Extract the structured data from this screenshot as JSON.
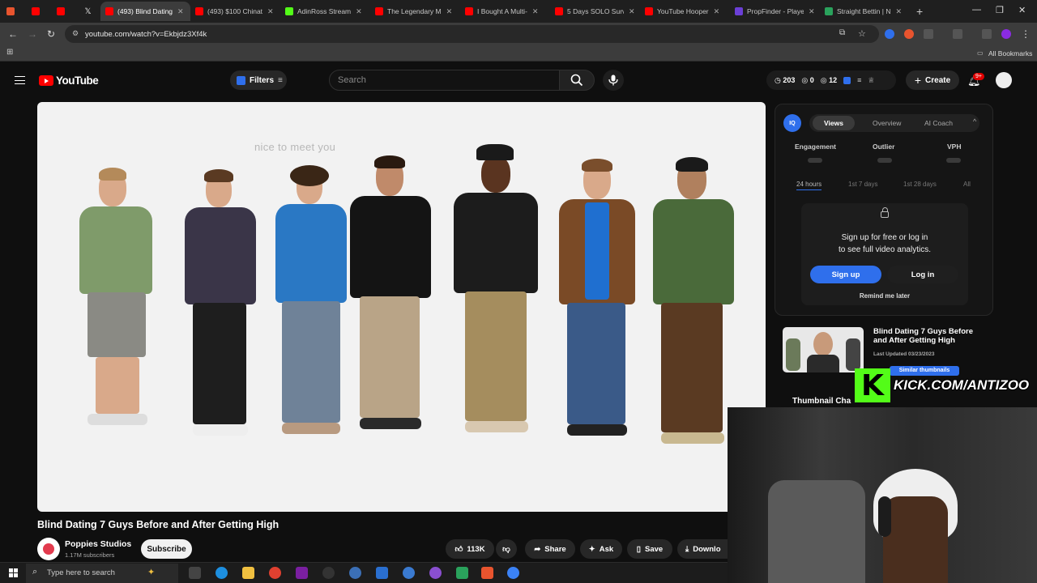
{
  "browser": {
    "tabs": [
      {
        "label": "",
        "color": "#e8542e"
      },
      {
        "label": "",
        "color": "#ff0000"
      },
      {
        "label": "",
        "color": "#ff0000"
      },
      {
        "label": "",
        "color": "#000000"
      },
      {
        "label": "(493) Blind Dating",
        "color": "#ff0000",
        "active": true
      },
      {
        "label": "(493) $100 Chinat",
        "color": "#ff0000"
      },
      {
        "label": "AdinRoss Stream",
        "color": "#53fc18"
      },
      {
        "label": "The Legendary M",
        "color": "#ff0000"
      },
      {
        "label": "I Bought A Multi-",
        "color": "#ff0000"
      },
      {
        "label": "5 Days SOLO Surv",
        "color": "#ff0000"
      },
      {
        "label": "YouTube Hooper",
        "color": "#ff0000"
      },
      {
        "label": "PropFinder - Playe",
        "color": "#6b3fd6"
      },
      {
        "label": "Straight Bettin | N",
        "color": "#2aa25c"
      }
    ],
    "new_tab": "+",
    "url": "youtube.com/watch?v=Ekbjdz3Xf4k",
    "bookmarks_label": "All Bookmarks"
  },
  "youtube": {
    "logo_text": "YouTube",
    "filters_label": "Filters",
    "search_placeholder": "Search",
    "stats": {
      "a": "203",
      "b": "0",
      "c": "12"
    },
    "create_label": "Create",
    "notif_badge": "9+",
    "caption": "nice to meet you",
    "video_title": "Blind Dating 7 Guys Before and After Getting High",
    "channel_name": "Poppies Studios",
    "subscribers": "1.17M subscribers",
    "subscribe_label": "Subscribe",
    "likes": "113K",
    "share_label": "Share",
    "ask_label": "Ask",
    "save_label": "Save",
    "download_label": "Downlo"
  },
  "panel": {
    "iq_label": "IQ",
    "tabs": [
      "Views",
      "Overview",
      "AI Coach"
    ],
    "metrics": [
      "Engagement",
      "Outlier",
      "VPH"
    ],
    "ranges": [
      "24 hours",
      "1st 7 days",
      "1st 28 days",
      "All"
    ],
    "lock_text_1": "Sign up for free or log in",
    "lock_text_2": "to see full video analytics.",
    "signup_label": "Sign up",
    "login_label": "Log in",
    "remind_label": "Remind me later",
    "suggestion_title": "Blind Dating 7 Guys Before and After Getting High",
    "suggestion_date": "Last Updated 03/23/2023",
    "similar_label": "Similar thumbnails",
    "thumbnail_checker": "Thumbnail Cha"
  },
  "overlay": {
    "kick_k": "K",
    "kick_text": "KICK.COM/ANTIZOO"
  },
  "taskbar": {
    "search_text": "Type here to search"
  }
}
